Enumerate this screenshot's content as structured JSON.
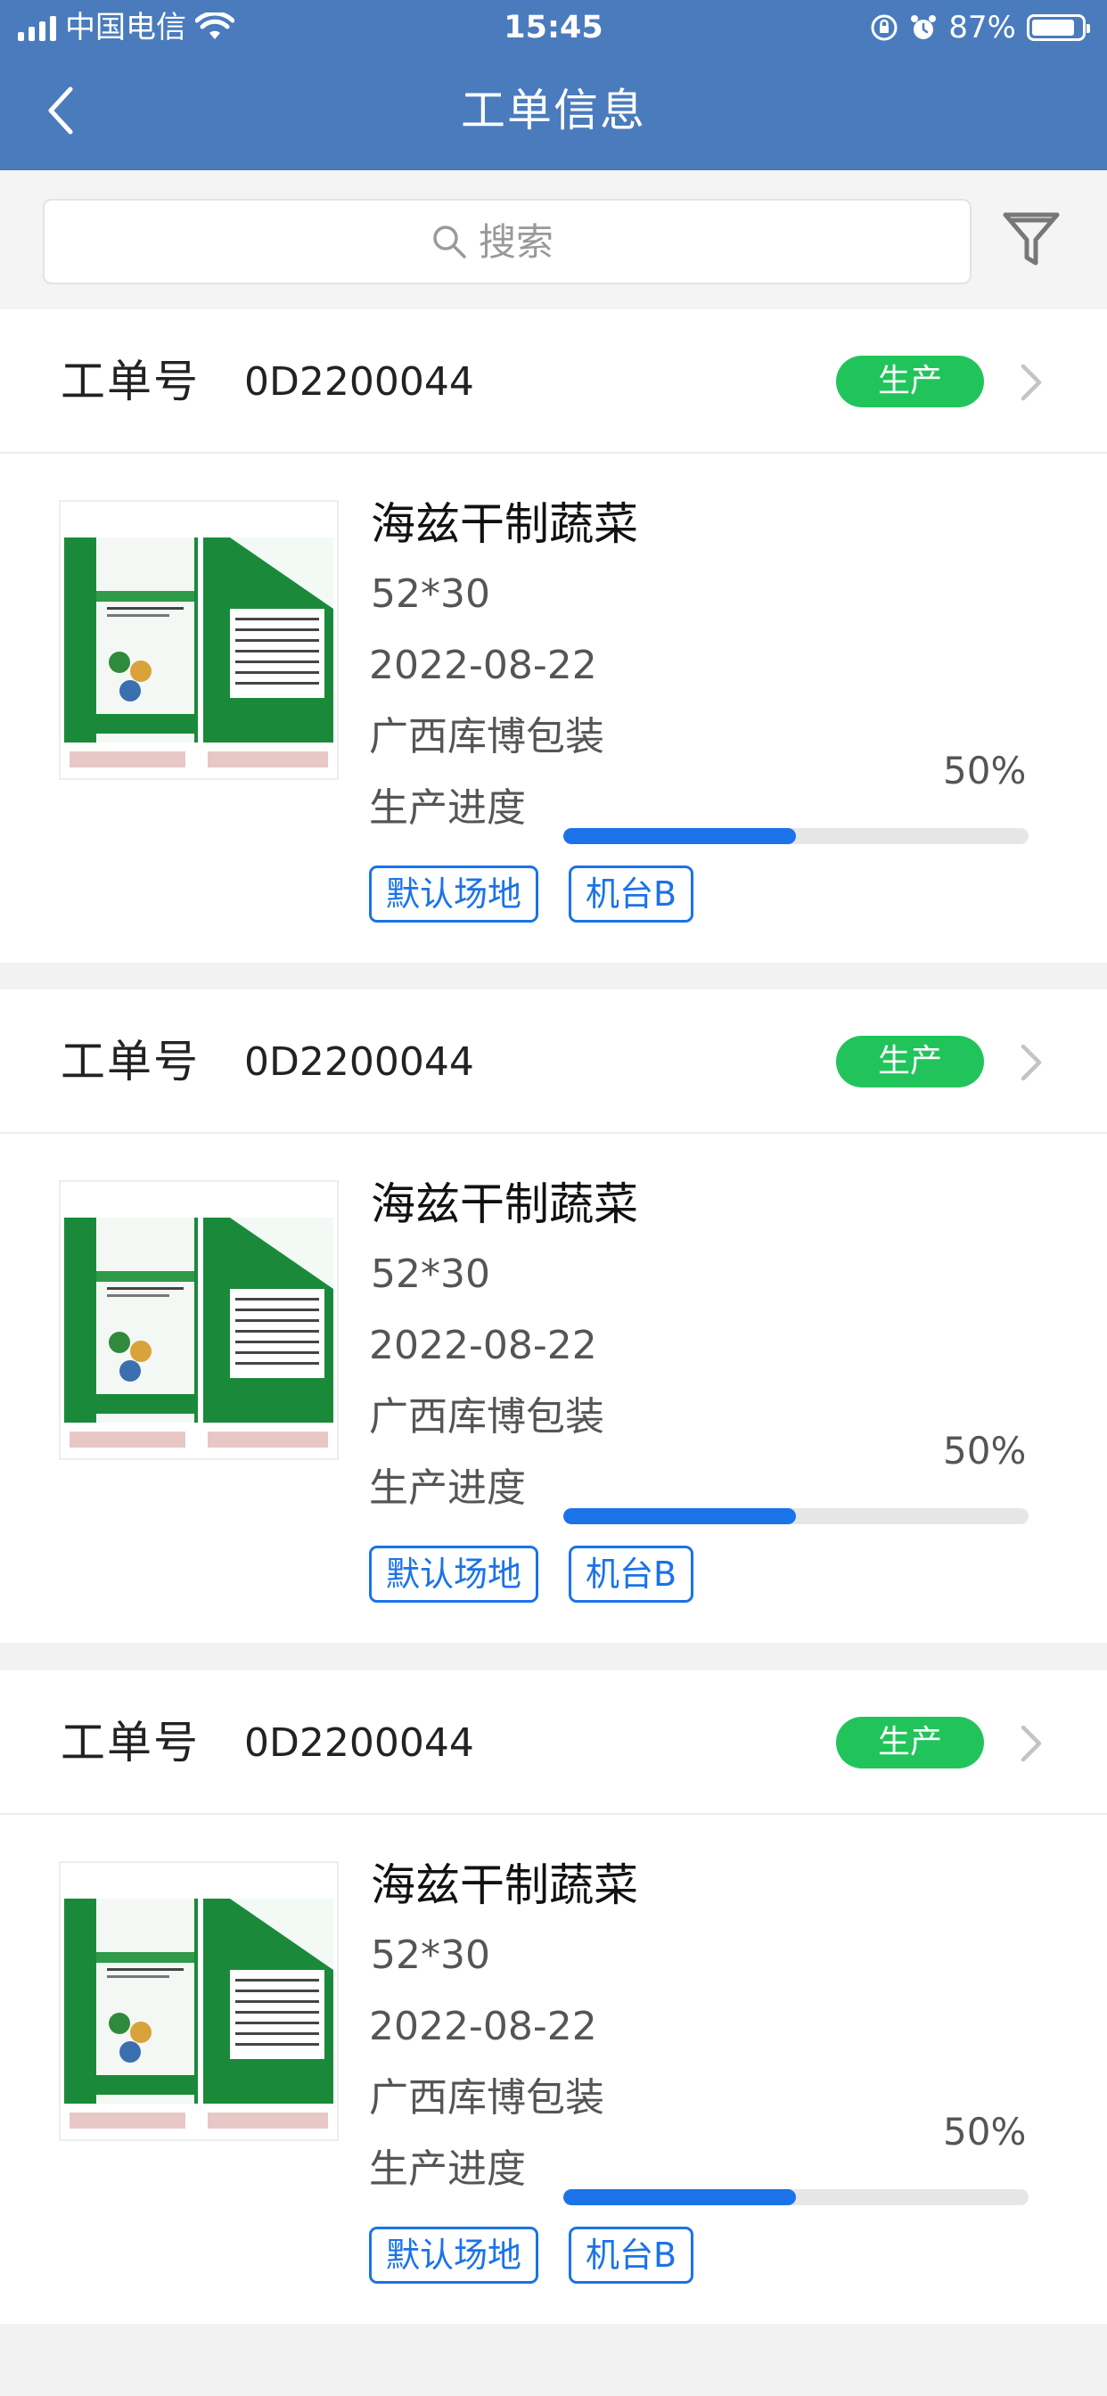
{
  "status_bar": {
    "carrier": "中国电信",
    "time": "15:45",
    "battery_text": "87%",
    "battery_level": 0.87,
    "icons": [
      "signal-icon",
      "wifi-icon",
      "rotation-lock-icon",
      "alarm-icon",
      "battery-icon"
    ]
  },
  "nav": {
    "title": "工单信息",
    "back_icon": "chevron-left-icon"
  },
  "search": {
    "placeholder": "搜索",
    "value": "",
    "filter_icon": "filter-icon"
  },
  "orders": [
    {
      "order_label": "工单号",
      "order_no": "0D2200044",
      "status": "生产",
      "product_name": "海兹干制蔬菜",
      "spec": "52*30",
      "date": "2022-08-22",
      "company": "广西库博包装",
      "progress_label": "生产进度",
      "progress_text": "50%",
      "progress": 0.5,
      "tags": [
        "默认场地",
        "机台B"
      ]
    },
    {
      "order_label": "工单号",
      "order_no": "0D2200044",
      "status": "生产",
      "product_name": "海兹干制蔬菜",
      "spec": "52*30",
      "date": "2022-08-22",
      "company": "广西库博包装",
      "progress_label": "生产进度",
      "progress_text": "50%",
      "progress": 0.5,
      "tags": [
        "默认场地",
        "机台B"
      ]
    },
    {
      "order_label": "工单号",
      "order_no": "0D2200044",
      "status": "生产",
      "product_name": "海兹干制蔬菜",
      "spec": "52*30",
      "date": "2022-08-22",
      "company": "广西库博包装",
      "progress_label": "生产进度",
      "progress_text": "50%",
      "progress": 0.5,
      "tags": [
        "默认场地",
        "机台B"
      ]
    }
  ],
  "colors": {
    "header_bg": "#4a7bbd",
    "status_green": "#21c45a",
    "accent_blue": "#1a73e8",
    "page_bg": "#f2f2f2"
  }
}
